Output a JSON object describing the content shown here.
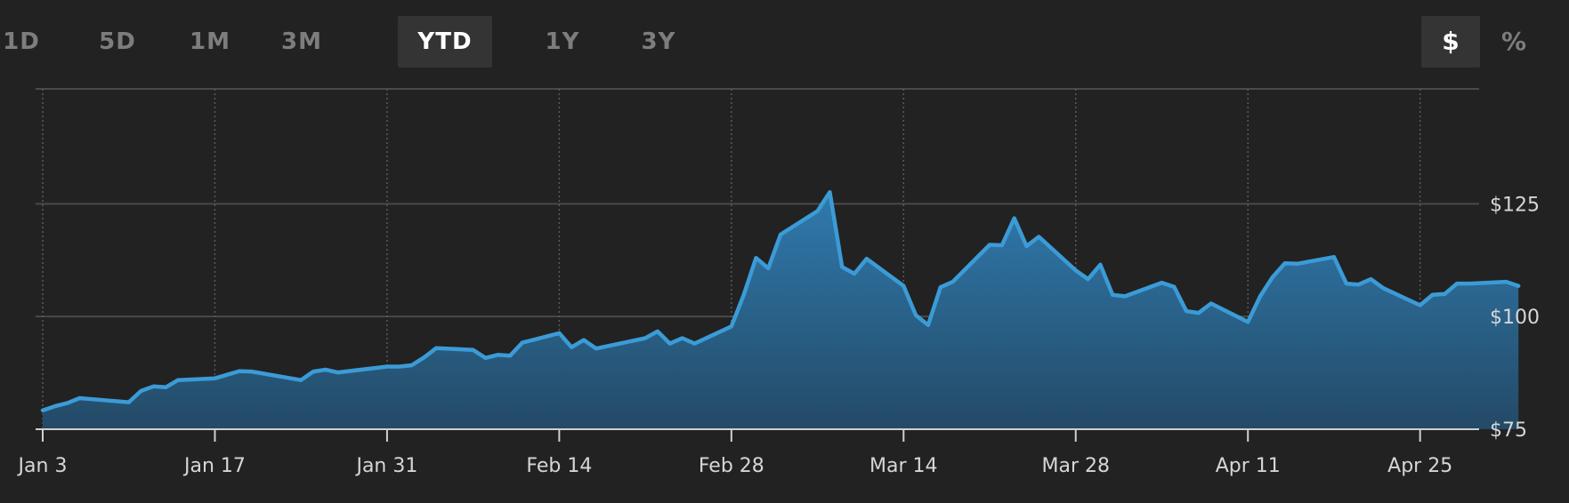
{
  "range_tabs": [
    {
      "label": "1D",
      "active": false
    },
    {
      "label": "5D",
      "active": false
    },
    {
      "label": "1M",
      "active": false
    },
    {
      "label": "3M",
      "active": false
    },
    {
      "label": "YTD",
      "active": true
    },
    {
      "label": "1Y",
      "active": false
    },
    {
      "label": "3Y",
      "active": false
    }
  ],
  "unit_toggle": {
    "dollar_label": "$",
    "percent_label": "%",
    "selected": "$"
  },
  "colors": {
    "background": "#222222",
    "line": "#3b9bd6",
    "fill_top": "#2f7aae",
    "fill_bottom": "#244a66",
    "grid": "#4a4a4a",
    "axis": "#d0d0d0"
  },
  "chart_data": {
    "type": "area",
    "title": "",
    "xlabel": "",
    "ylabel": "",
    "x_ticks": [
      {
        "label": "Jan 3",
        "day": 3
      },
      {
        "label": "Jan 17",
        "day": 17
      },
      {
        "label": "Jan 31",
        "day": 31
      },
      {
        "label": "Feb 14",
        "day": 45
      },
      {
        "label": "Feb 28",
        "day": 59
      },
      {
        "label": "Mar 14",
        "day": 73
      },
      {
        "label": "Mar 28",
        "day": 87
      },
      {
        "label": "Apr 11",
        "day": 101
      },
      {
        "label": "Apr 25",
        "day": 115
      }
    ],
    "y_ticks": [
      {
        "label": "$75",
        "value": 75
      },
      {
        "label": "$100",
        "value": 100
      },
      {
        "label": "$125",
        "value": 125
      }
    ],
    "xlim": [
      3,
      119.8
    ],
    "ylim": [
      75,
      150.5
    ],
    "grid": true,
    "legend": "none",
    "series": [
      {
        "points": [
          [
            3,
            79.2
          ],
          [
            4,
            80.1
          ],
          [
            5,
            80.8
          ],
          [
            6,
            81.9
          ],
          [
            10,
            81.0
          ],
          [
            11,
            83.5
          ],
          [
            12,
            84.5
          ],
          [
            13,
            84.3
          ],
          [
            14,
            85.9
          ],
          [
            17,
            86.3
          ],
          [
            19,
            87.9
          ],
          [
            20,
            87.8
          ],
          [
            24,
            85.9
          ],
          [
            25,
            87.8
          ],
          [
            26,
            88.2
          ],
          [
            27,
            87.6
          ],
          [
            31,
            88.9
          ],
          [
            32,
            88.9
          ],
          [
            33,
            89.2
          ],
          [
            34,
            90.9
          ],
          [
            35,
            93.0
          ],
          [
            38,
            92.6
          ],
          [
            39,
            90.8
          ],
          [
            40,
            91.5
          ],
          [
            41,
            91.3
          ],
          [
            42,
            94.2
          ],
          [
            45,
            96.3
          ],
          [
            46,
            93.2
          ],
          [
            47,
            94.8
          ],
          [
            48,
            92.9
          ],
          [
            52,
            95.2
          ],
          [
            53,
            96.7
          ],
          [
            54,
            94.0
          ],
          [
            55,
            95.2
          ],
          [
            56,
            94.0
          ],
          [
            59,
            97.8
          ],
          [
            60,
            104.8
          ],
          [
            61,
            113.0
          ],
          [
            62,
            110.7
          ],
          [
            63,
            118.2
          ],
          [
            66,
            123.4
          ],
          [
            67,
            127.6
          ],
          [
            68,
            111.0
          ],
          [
            69,
            109.5
          ],
          [
            70,
            112.8
          ],
          [
            73,
            106.8
          ],
          [
            74,
            100.3
          ],
          [
            75,
            98.1
          ],
          [
            76,
            106.5
          ],
          [
            77,
            107.7
          ],
          [
            80,
            115.9
          ],
          [
            81,
            115.8
          ],
          [
            82,
            121.8
          ],
          [
            83,
            115.6
          ],
          [
            84,
            117.7
          ],
          [
            87,
            110.2
          ],
          [
            88,
            108.3
          ],
          [
            89,
            111.5
          ],
          [
            90,
            104.8
          ],
          [
            91,
            104.5
          ],
          [
            94,
            107.5
          ],
          [
            95,
            106.6
          ],
          [
            96,
            101.2
          ],
          [
            97,
            100.8
          ],
          [
            98,
            102.9
          ],
          [
            101,
            98.8
          ],
          [
            102,
            104.5
          ],
          [
            103,
            108.7
          ],
          [
            104,
            111.8
          ],
          [
            105,
            111.7
          ],
          [
            108,
            113.2
          ],
          [
            109,
            107.3
          ],
          [
            110,
            107.1
          ],
          [
            111,
            108.3
          ],
          [
            112,
            106.3
          ],
          [
            115,
            102.5
          ],
          [
            116,
            104.8
          ],
          [
            117,
            105.0
          ],
          [
            118,
            107.3
          ],
          [
            119,
            107.3
          ],
          [
            122,
            107.7
          ],
          [
            123,
            106.8
          ]
        ]
      }
    ]
  }
}
